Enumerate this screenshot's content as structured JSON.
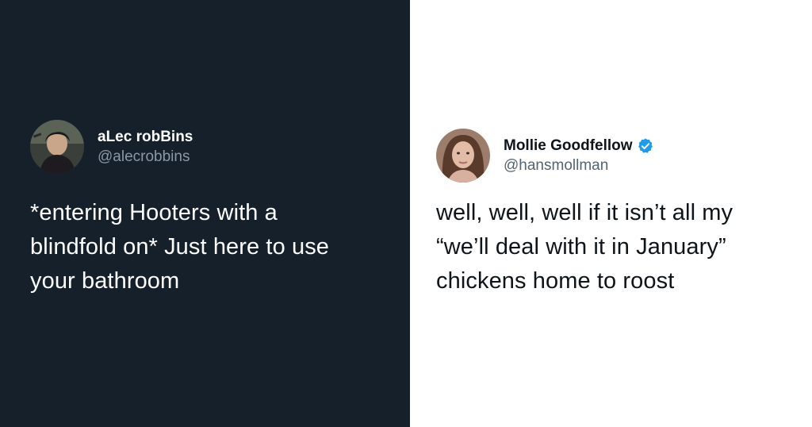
{
  "left_tweet": {
    "display_name": "aLec robBins",
    "handle": "@alecrobbins",
    "text": "*entering Hooters with a\nblindfold on* Just here to use\nyour bathroom",
    "background": "#15202b"
  },
  "right_tweet": {
    "display_name": "Mollie Goodfellow",
    "handle": "@hansmollman",
    "verified_icon": "verified-badge-icon",
    "text": "well, well, well if it isn’t all my\n“we’ll deal with it in January”\nchickens home to roost",
    "background": "#ffffff",
    "verified_color": "#1d9bf0"
  }
}
